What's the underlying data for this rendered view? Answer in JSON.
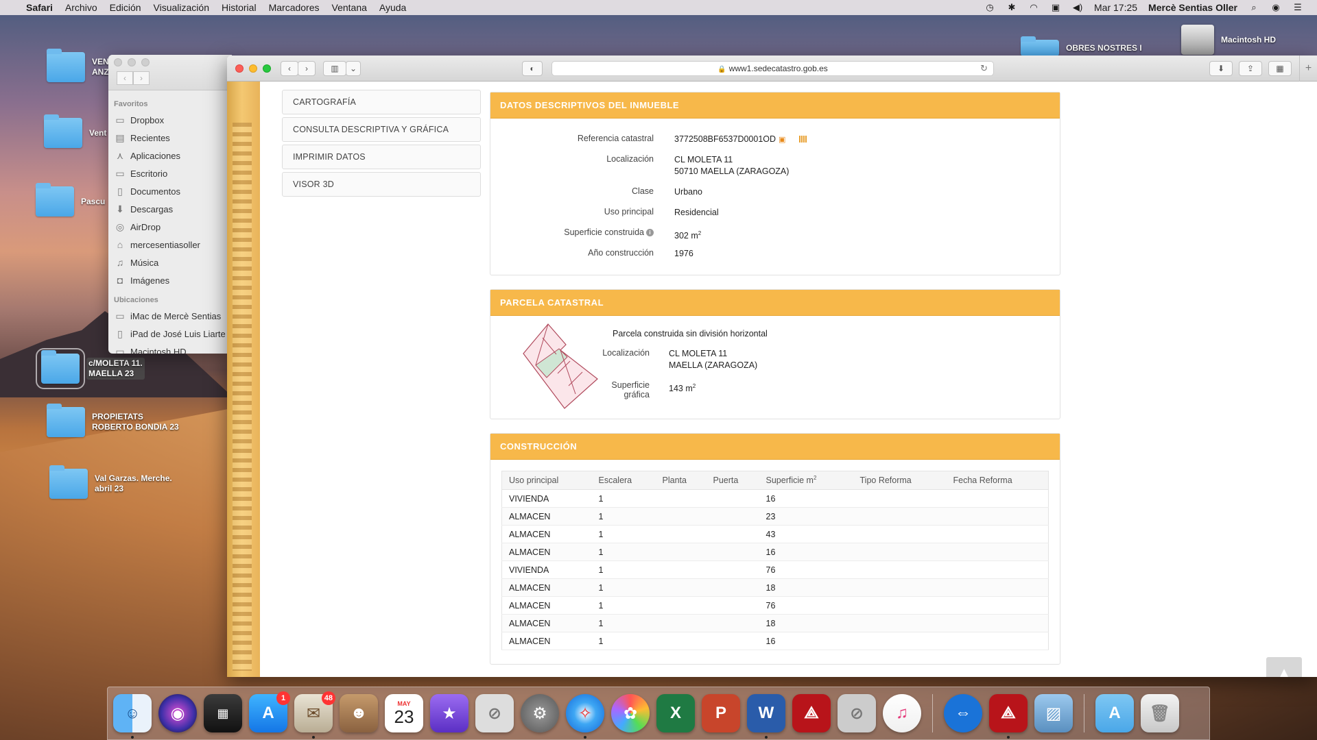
{
  "menubar": {
    "app": "Safari",
    "menus": [
      "Archivo",
      "Edición",
      "Visualización",
      "Historial",
      "Marcadores",
      "Ventana",
      "Ayuda"
    ],
    "clock": "Mar 17:25",
    "user": "Mercè Sentias Oller"
  },
  "desktop": {
    "folders": [
      {
        "label": "VEN\nANZ"
      },
      {
        "label": "Vent"
      },
      {
        "label": "Pascu"
      },
      {
        "label": "c/MOLETA 11.\nMAELLA 23"
      },
      {
        "label": "PROPIETATS\nROBERTO BONDIA 23"
      },
      {
        "label": "Val Garzas. Merche.\nabril 23"
      },
      {
        "label": "OBRES NOSTRES I"
      }
    ],
    "hd_label": "Macintosh HD"
  },
  "finder": {
    "section_favorites": "Favoritos",
    "favorites": [
      "Dropbox",
      "Recientes",
      "Aplicaciones",
      "Escritorio",
      "Documentos",
      "Descargas",
      "AirDrop",
      "mercesentiasoller",
      "Música",
      "Imágenes"
    ],
    "section_locations": "Ubicaciones",
    "locations": [
      "iMac de Mercè Sentias",
      "iPad de José Luis Liarte",
      "Macintosh HD"
    ]
  },
  "browser": {
    "url": "www1.sedecatastro.gob.es"
  },
  "sidemenu": {
    "items": [
      "CARTOGRAFÍA",
      "CONSULTA DESCRIPTIVA Y GRÁFICA",
      "IMPRIMIR DATOS",
      "VISOR 3D"
    ]
  },
  "datos": {
    "title": "DATOS DESCRIPTIVOS DEL INMUEBLE",
    "ref_label": "Referencia catastral",
    "ref_value": "3772508BF6537D0001OD",
    "loc_label": "Localización",
    "loc_line1": "CL MOLETA 11",
    "loc_line2": "50710 MAELLA (ZARAGOZA)",
    "clase_label": "Clase",
    "clase_value": "Urbano",
    "uso_label": "Uso principal",
    "uso_value": "Residencial",
    "sup_label": "Superficie construida",
    "sup_value": "302 m",
    "ano_label": "Año construcción",
    "ano_value": "1976"
  },
  "parcela": {
    "title": "PARCELA CATASTRAL",
    "subtitle": "Parcela construida sin división horizontal",
    "loc_label": "Localización",
    "loc_line1": "CL MOLETA 11",
    "loc_line2": "MAELLA (ZARAGOZA)",
    "sup_label": "Superficie gráfica",
    "sup_value": "143 m"
  },
  "construccion": {
    "title": "CONSTRUCCIÓN",
    "headers": [
      "Uso principal",
      "Escalera",
      "Planta",
      "Puerta",
      "Superficie m",
      "Tipo Reforma",
      "Fecha Reforma"
    ],
    "rows": [
      [
        "VIVIENDA",
        "1",
        "",
        "",
        "16",
        "",
        ""
      ],
      [
        "ALMACEN",
        "1",
        "",
        "",
        "23",
        "",
        ""
      ],
      [
        "ALMACEN",
        "1",
        "",
        "",
        "43",
        "",
        ""
      ],
      [
        "ALMACEN",
        "1",
        "",
        "",
        "16",
        "",
        ""
      ],
      [
        "VIVIENDA",
        "1",
        "",
        "",
        "76",
        "",
        ""
      ],
      [
        "ALMACEN",
        "1",
        "",
        "",
        "18",
        "",
        ""
      ],
      [
        "ALMACEN",
        "1",
        "",
        "",
        "76",
        "",
        ""
      ],
      [
        "ALMACEN",
        "1",
        "",
        "",
        "18",
        "",
        ""
      ],
      [
        "ALMACEN",
        "1",
        "",
        "",
        "16",
        "",
        ""
      ]
    ]
  },
  "dock": {
    "appstore_badge": "1",
    "mail_badge": "48",
    "calendar_month": "MAY",
    "calendar_day": "23"
  },
  "colors": {
    "panel_header": "#f7b84a",
    "accent": "#e88a1a"
  }
}
